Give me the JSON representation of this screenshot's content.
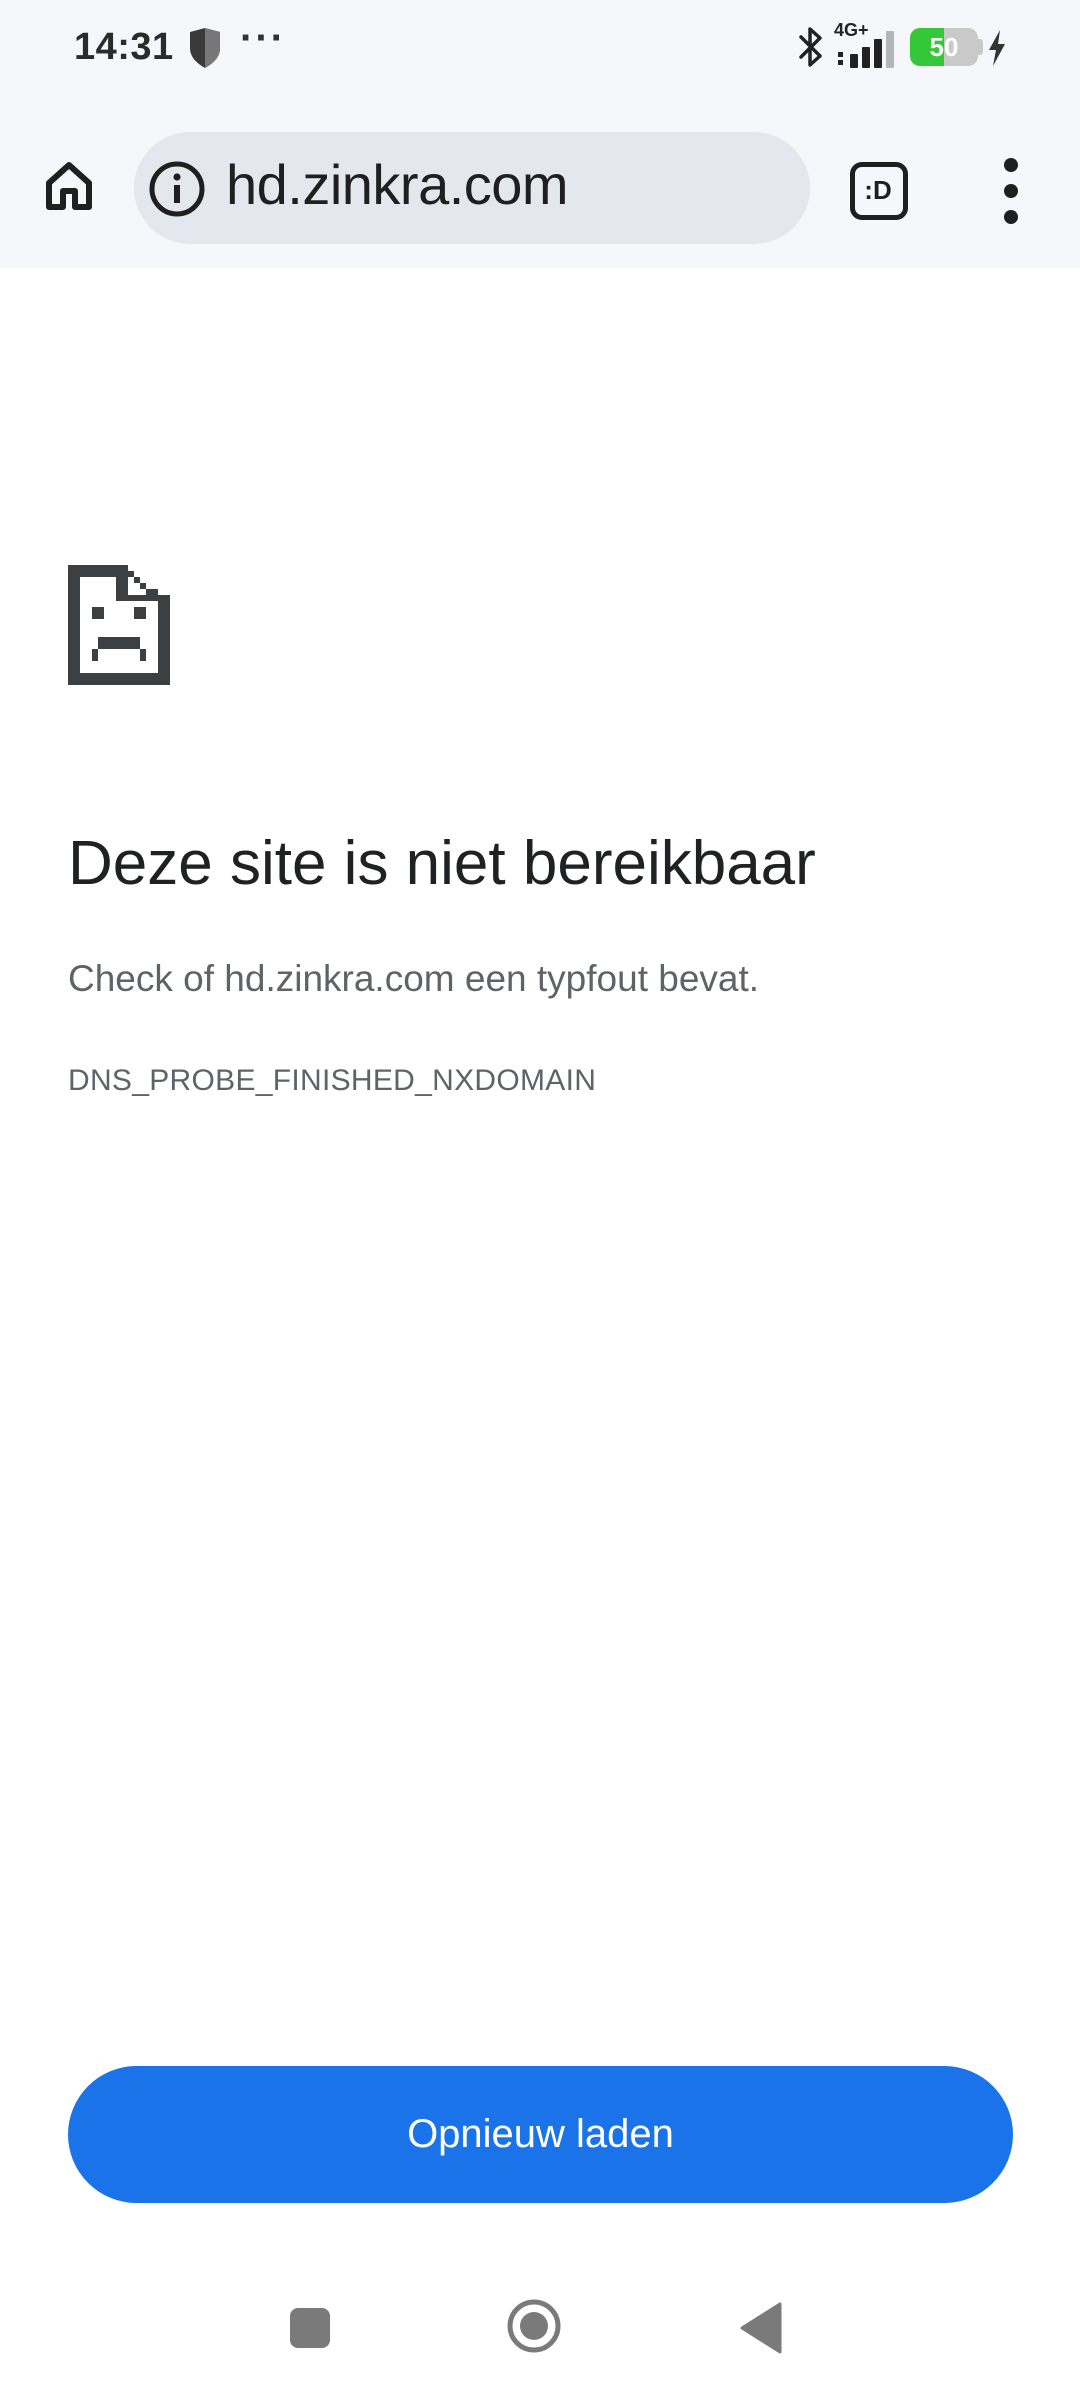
{
  "status_bar": {
    "time": "14:31",
    "overflow_dots": "···",
    "network": "4G+",
    "battery_level": 50,
    "battery_text": "50",
    "battery_color": "#34c738",
    "icons": [
      "shield-icon",
      "bluetooth-icon",
      "signal-icon",
      "battery-icon",
      "charging-bolt-icon"
    ]
  },
  "toolbar": {
    "url": "hd.zinkra.com",
    "tab_switcher_label": ":D",
    "icons": [
      "home-icon",
      "info-icon",
      "tab-switcher-icon",
      "more-menu-icon"
    ]
  },
  "error_page": {
    "icon": "sad-page-icon",
    "title": "Deze site is niet bereikbaar",
    "hint": "Check of hd.zinkra.com een typfout bevat.",
    "error_code": "DNS_PROBE_FINISHED_NXDOMAIN",
    "reload_label": "Opnieuw laden",
    "accent_color": "#1a73e8"
  },
  "nav_bar": {
    "icons": [
      "recents-icon",
      "home-circle-icon",
      "back-icon"
    ]
  }
}
